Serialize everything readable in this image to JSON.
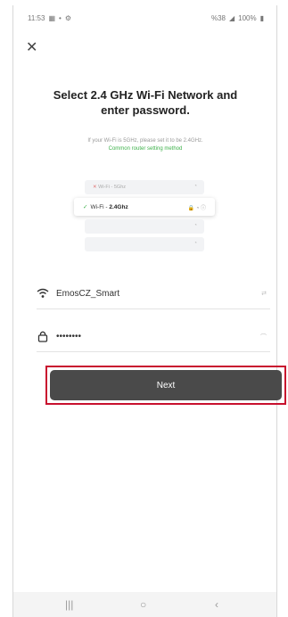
{
  "status_bar": {
    "time": "11:53",
    "left_icons": [
      "calendar-icon",
      "dot-icon",
      "settings-icon"
    ],
    "signal_text": "%38",
    "battery": "100%"
  },
  "title": "Select 2.4 GHz Wi-Fi Network and enter password.",
  "hint": {
    "text": "If your Wi-Fi is 5GHz, please set it to be 2.4GHz.",
    "link": "Common router setting method"
  },
  "illustration": {
    "row_5g": "Wi-Fi - 5Ghz",
    "row_24_prefix": "Wi-Fi - ",
    "row_24_band": "2.4Ghz"
  },
  "wifi_field": {
    "icon": "wifi-icon",
    "value": "EmosCZ_Smart",
    "right_icon": "switch-network-icon"
  },
  "password_field": {
    "icon": "lock-icon",
    "value": "••••••••",
    "right_icon": "eye-off-icon"
  },
  "next_label": "Next",
  "nav_bar": [
    "recents-icon",
    "home-icon",
    "back-icon"
  ],
  "colors": {
    "accent_green": "#3db14a",
    "button_bg": "#4a4a4a",
    "highlight_red": "#c8102e"
  }
}
